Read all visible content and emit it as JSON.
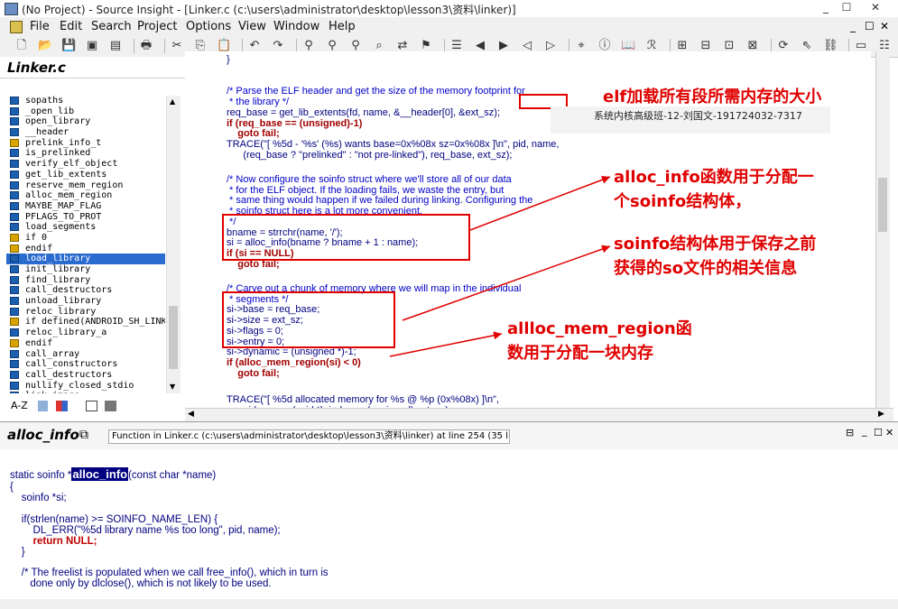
{
  "window": {
    "title": "(No Project) - Source Insight - [Linker.c (c:\\users\\administrator\\desktop\\lesson3\\资料\\linker)]"
  },
  "window_buttons": [
    "_",
    "☐",
    "✕"
  ],
  "mdi_buttons": [
    "_",
    "☐",
    "✕"
  ],
  "menu": [
    "File",
    "Edit",
    "Search",
    "Project",
    "Options",
    "View",
    "Window",
    "Help"
  ],
  "toolbar_icons": [
    "new-file-icon",
    "open-icon",
    "save-icon",
    "save-all-icon",
    "close-file-icon",
    "print-icon",
    "cut-icon",
    "copy-icon",
    "paste-icon",
    "undo-icon",
    "redo-icon",
    "search-icon",
    "search-files-icon",
    "search-project-icon",
    "lookup-references-icon",
    "replace-icon",
    "bookmark-icon",
    "bookmark-list-icon",
    "back-icon",
    "forward-icon",
    "jump-left-icon",
    "jump-right-icon",
    "browse-symbol-icon",
    "symbol-info-icon",
    "book-icon",
    "relation-icon",
    "window-1-icon",
    "window-2-icon",
    "window-3-icon",
    "window-4-icon",
    "sync-icon",
    "select-icon",
    "link-icon",
    "context-icon",
    "tile-icon",
    "cascade-icon"
  ],
  "left_panel": {
    "title": "Linker.c",
    "symbols": [
      {
        "name": "sopaths",
        "kind": "var"
      },
      {
        "name": "_open_lib",
        "kind": "fn"
      },
      {
        "name": "open_library",
        "kind": "fn"
      },
      {
        "name": "__header",
        "kind": "var"
      },
      {
        "name": "prelink_info_t",
        "kind": "type"
      },
      {
        "name": "is_prelinked",
        "kind": "fn"
      },
      {
        "name": "verify_elf_object",
        "kind": "fn"
      },
      {
        "name": "get_lib_extents",
        "kind": "fn"
      },
      {
        "name": "reserve_mem_region",
        "kind": "fn"
      },
      {
        "name": "alloc_mem_region",
        "kind": "fn"
      },
      {
        "name": "MAYBE_MAP_FLAG",
        "kind": "macro"
      },
      {
        "name": "PFLAGS_TO_PROT",
        "kind": "macro"
      },
      {
        "name": "load_segments",
        "kind": "fn"
      },
      {
        "name": "if 0",
        "kind": "pp"
      },
      {
        "name": "endif",
        "kind": "pp"
      },
      {
        "name": "load_library",
        "kind": "fn",
        "selected": true
      },
      {
        "name": "init_library",
        "kind": "fn"
      },
      {
        "name": "find_library",
        "kind": "fn"
      },
      {
        "name": "call_destructors",
        "kind": "fn"
      },
      {
        "name": "unload_library",
        "kind": "fn"
      },
      {
        "name": "reloc_library",
        "kind": "fn"
      },
      {
        "name": "if defined(ANDROID_SH_LINKE",
        "kind": "pp"
      },
      {
        "name": "reloc_library_a",
        "kind": "fn"
      },
      {
        "name": "endif",
        "kind": "pp"
      },
      {
        "name": "call_array",
        "kind": "fn"
      },
      {
        "name": "call_constructors",
        "kind": "fn"
      },
      {
        "name": "call_destructors",
        "kind": "fn"
      },
      {
        "name": "nullify_closed_stdio",
        "kind": "fn"
      },
      {
        "name": "link_image",
        "kind": "fn"
      }
    ],
    "footer": "A-Z"
  },
  "code_lines": [
    "}",
    "",
    "/* Parse the ELF header and get the size of the memory footprint for",
    " * the library */",
    "req_base = get_lib_extents(fd, name, &__header[0], &ext_sz);",
    "if (req_base == (unsigned)-1)",
    "    goto fail;",
    "TRACE(\"[ %5d - '%s' (%s) wants base=0x%08x sz=0x%08x ]\\n\", pid, name,",
    "      (req_base ? \"prelinked\" : \"not pre-linked\"), req_base, ext_sz);",
    "",
    "/* Now configure the soinfo struct where we'll store all of our data",
    " * for the ELF object. If the loading fails, we waste the entry, but",
    " * same thing would happen if we failed during linking. Configuring the",
    " * soinfo struct here is a lot more convenient.",
    " */",
    "bname = strrchr(name, '/');",
    "si = alloc_info(bname ? bname + 1 : name);",
    "if (si == NULL)",
    "    goto fail;",
    "",
    "/* Carve out a chunk of memory where we will map in the individual",
    " * segments */",
    "si->base = req_base;",
    "si->size = ext_sz;",
    "si->flags = 0;",
    "si->entry = 0;",
    "si->dynamic = (unsigned *)-1;",
    "if (alloc_mem_region(si) < 0)",
    "    goto fail;",
    "",
    "TRACE(\"[ %5d allocated memory for %s @ %p (0x%08x) ]\\n\",",
    "      pid, name, (void *)si->base, (unsigned) ext_sz);"
  ],
  "annotations": {
    "a1": "elf加载所有段所需内存的大小",
    "a2_l1": "alloc_info函数用于分配一",
    "a2_l2": "个soinfo结构体，",
    "a3_l1": "soinfo结构体用于保存之前",
    "a3_l2": "获得的so文件的相关信息",
    "a4_l1": "allloc_mem_region函",
    "a4_l2": "数用于分配一块内存",
    "watermark": "系统内核高级班-12-刘国文-191724032-7317"
  },
  "context": {
    "title": "alloc_info",
    "info": "Function in Linker.c (c:\\users\\administrator\\desktop\\lesson3\\资料\\linker) at line 254 (35 lines)",
    "lines": [
      "static soinfo *",
      "alloc_info",
      "(const char *name)",
      "{",
      "    soinfo *si;",
      "",
      "    if(strlen(name) >= SOINFO_NAME_LEN) {",
      "        DL_ERR(\"%5d library name %s too long\", pid, name);",
      "        return NULL;",
      "    }",
      "",
      "    /* The freelist is populated when we call free_info(), which in turn is",
      "       done only by dlclose(), which is not likely to be used."
    ]
  },
  "colors": {
    "annotation": "#e00000",
    "selection": "#2a6bcf",
    "code": "#000080",
    "keyword": "#a00000"
  }
}
